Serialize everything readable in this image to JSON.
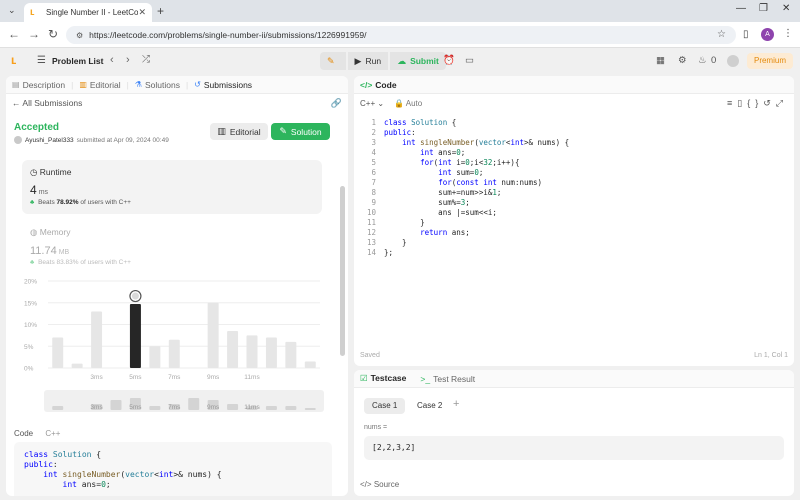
{
  "browser": {
    "tab_title": "Single Number II - LeetCode",
    "url": "https://leetcode.com/problems/single-number-ii/submissions/1226991959/",
    "profile_initial": "A"
  },
  "nav": {
    "problem_list": "Problem List",
    "run": "Run",
    "submit": "Submit",
    "fire_count": "0",
    "premium": "Premium"
  },
  "left": {
    "tabs": [
      {
        "label": "Description",
        "icon": "description-icon"
      },
      {
        "label": "Editorial",
        "icon": "book-icon"
      },
      {
        "label": "Solutions",
        "icon": "flask-icon"
      },
      {
        "label": "Submissions",
        "icon": "history-icon"
      }
    ],
    "all_submissions": "All Submissions",
    "status": "Accepted",
    "username": "Ayushi_Patel333",
    "submitted_text": "submitted at Apr 09, 2024 00:49",
    "editorial_btn": "Editorial",
    "solution_btn": "Solution",
    "runtime": {
      "title": "Runtime",
      "value": "4",
      "unit": "ms",
      "beats_prefix": "Beats",
      "beats_pct": "78.92%",
      "beats_suffix": "of users with C++"
    },
    "memory": {
      "title": "Memory",
      "value": "11.74",
      "unit": "MB",
      "beats_prefix": "Beats",
      "beats_pct": "83.83%",
      "beats_suffix": "of users with C++"
    },
    "code_label": "Code",
    "code_lang": "C++",
    "code_preview": [
      "class Solution {",
      "public:",
      "    int singleNumber(vector<int>& nums) {",
      "        int ans=0;"
    ]
  },
  "chart_data": {
    "type": "bar",
    "ylim": [
      0,
      20
    ],
    "y_ticks": [
      "0%",
      "5%",
      "10%",
      "15%",
      "20%"
    ],
    "x_tick_labels": [
      "3ms",
      "5ms",
      "7ms",
      "9ms",
      "11ms"
    ],
    "values": [
      7,
      1,
      13,
      0,
      14.7,
      5,
      6.5,
      0,
      15,
      8.5,
      7.5,
      7,
      6,
      1.5
    ],
    "highlight_index": 4,
    "mini_values": [
      2,
      0,
      3,
      5,
      6,
      2,
      3,
      6,
      5,
      3,
      2,
      2,
      2,
      1
    ],
    "mini_labels": [
      "3ms",
      "5ms",
      "7ms",
      "9ms",
      "11ms"
    ]
  },
  "code": {
    "title": "Code",
    "lang": "C++",
    "auto": "Auto",
    "saved": "Saved",
    "cursor": "Ln 1, Col 1",
    "lines": [
      "class Solution {",
      "public:",
      "    int singleNumber(vector<int>& nums) {",
      "        int ans=0;",
      "        for(int i=0;i<32;i++){",
      "            int sum=0;",
      "            for(const int num:nums)",
      "            sum+=num>>i&1;",
      "            sum%=3;",
      "            ans |=sum<<i;",
      "        }",
      "        return ans;",
      "    }",
      "};"
    ]
  },
  "test": {
    "tab_testcase": "Testcase",
    "tab_result": "Test Result",
    "case1": "Case 1",
    "case2": "Case 2",
    "var_label": "nums =",
    "var_value": "[2,2,3,2]",
    "source": "Source"
  },
  "colors": {
    "accent_green": "#2db55d",
    "leetcode_orange": "#f89f1b",
    "premium_bg": "#fdebd3"
  }
}
